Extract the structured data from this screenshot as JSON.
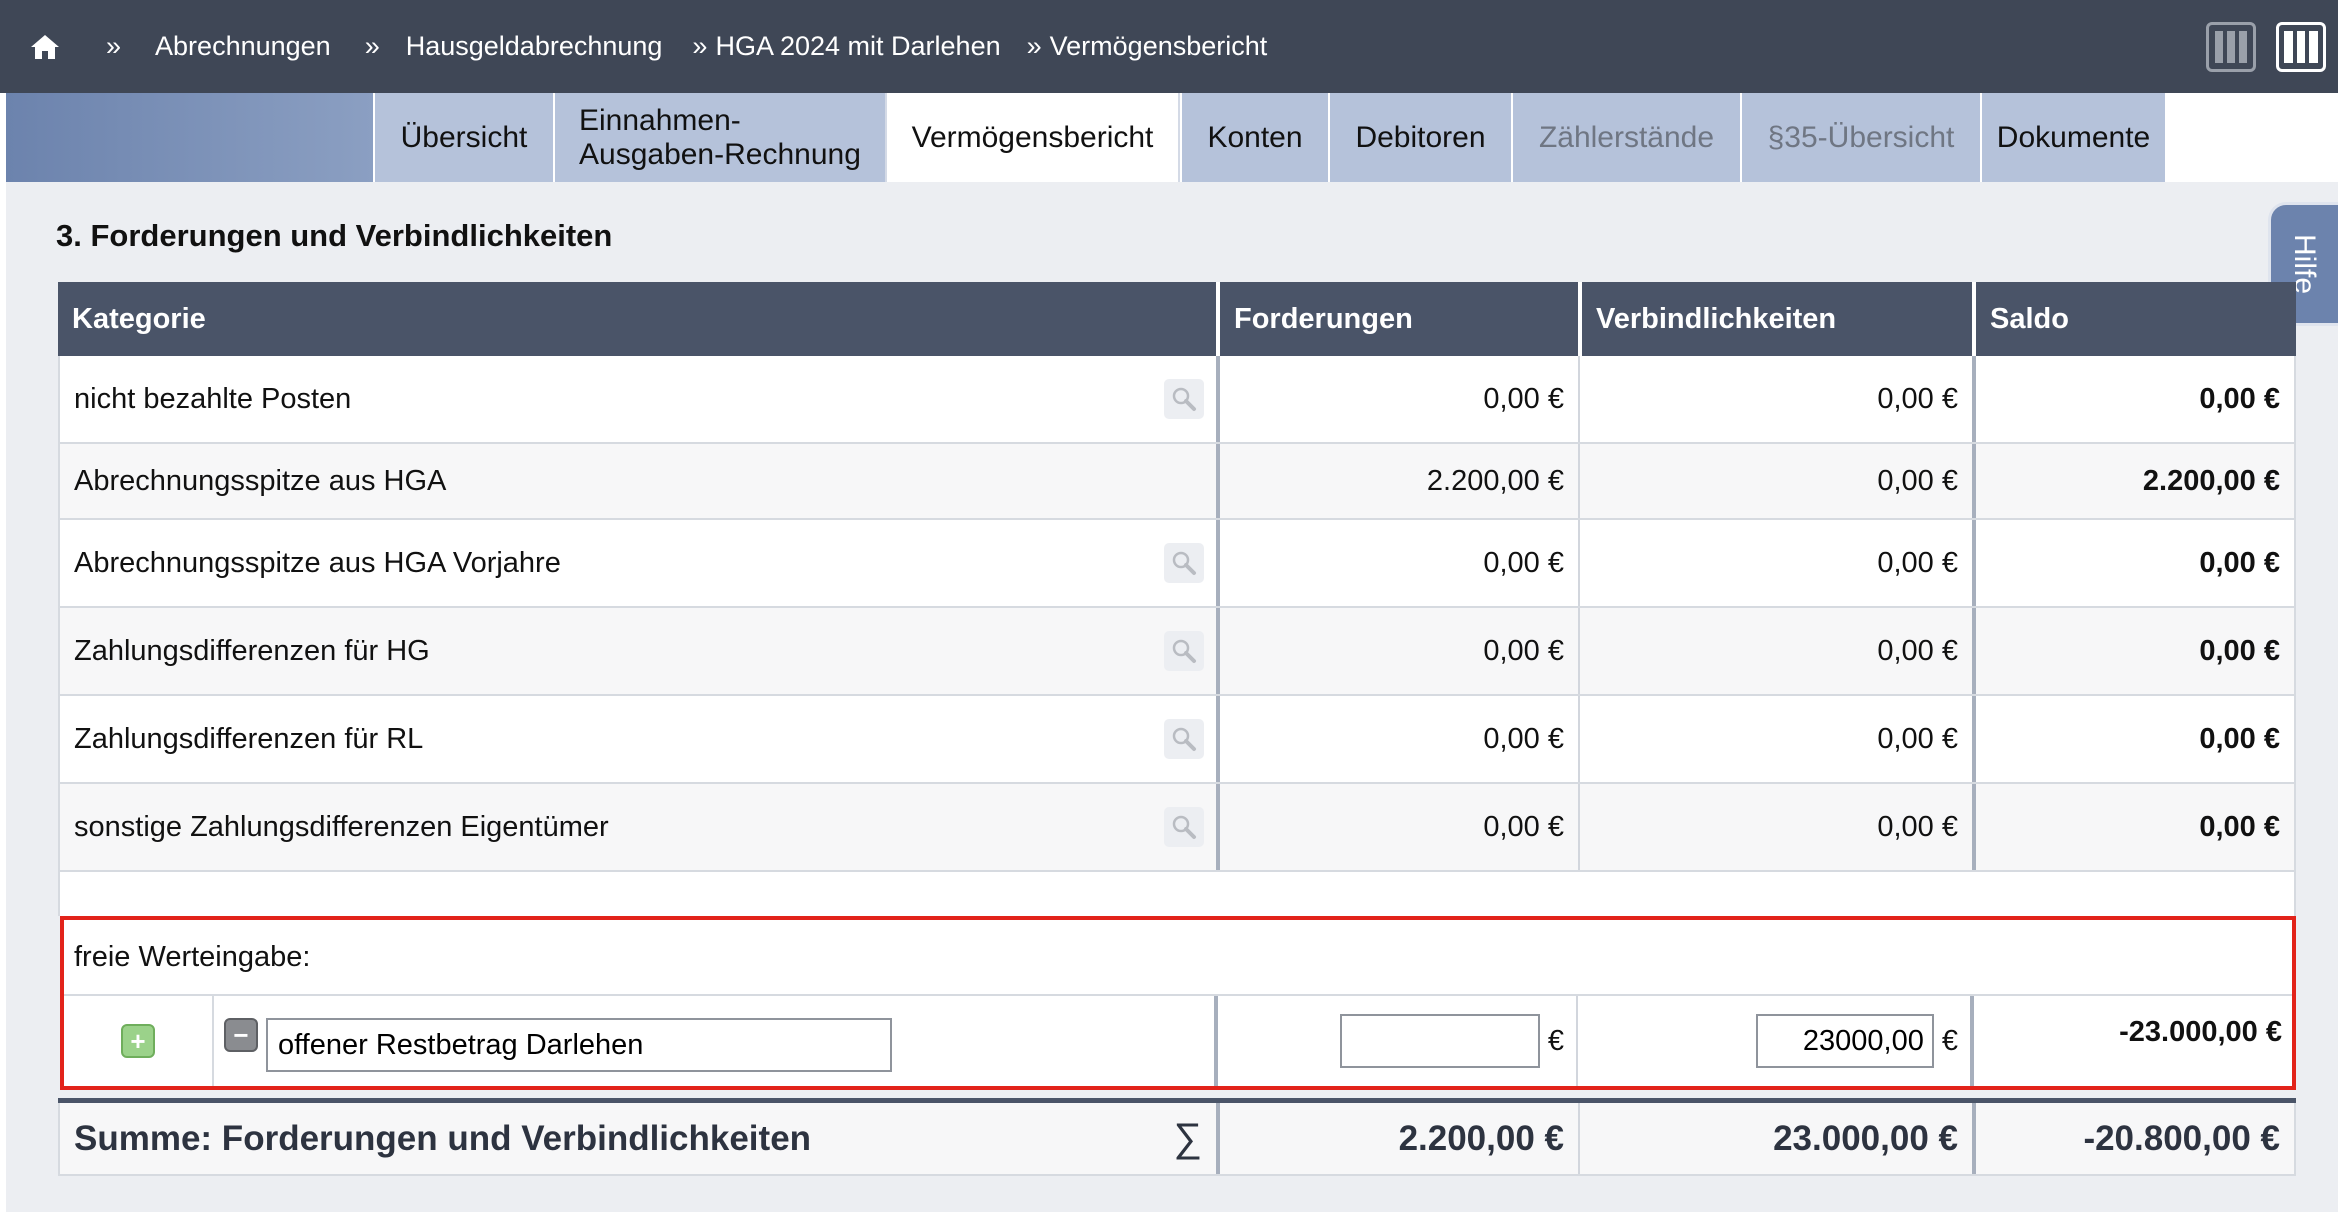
{
  "breadcrumb": {
    "home_icon": "home-icon",
    "separator": "»",
    "items": [
      "Abrechnungen",
      "Hausgeldabrechnung",
      "HGA 2024 mit Darlehen",
      "Vermögensbericht"
    ]
  },
  "layout_icons": [
    "layout-columns-icon",
    "layout-wide-icon"
  ],
  "tabs": [
    {
      "label": "Übersicht",
      "state": "normal"
    },
    {
      "label": "Einnahmen-Ausgaben-Rechnung",
      "state": "normal"
    },
    {
      "label": "Vermögensbericht",
      "state": "active"
    },
    {
      "label": "Konten",
      "state": "normal"
    },
    {
      "label": "Debitoren",
      "state": "normal"
    },
    {
      "label": "Zählerstände",
      "state": "disabled"
    },
    {
      "label": "§35-Übersicht",
      "state": "disabled"
    },
    {
      "label": "Dokumente",
      "state": "normal"
    }
  ],
  "help": {
    "label": "Hilfe"
  },
  "section": {
    "title": "3. Forderungen und Verbindlichkeiten"
  },
  "table": {
    "headers": [
      "Kategorie",
      "Forderungen",
      "Verbindlichkeiten",
      "Saldo"
    ],
    "rows": [
      {
        "kategorie": "nicht bezahlte Posten",
        "forderungen": "0,00 €",
        "verbindlichkeiten": "0,00 €",
        "saldo": "0,00 €",
        "has_search": true
      },
      {
        "kategorie": "Abrechnungsspitze aus HGA",
        "forderungen": "2.200,00 €",
        "verbindlichkeiten": "0,00 €",
        "saldo": "2.200,00 €",
        "has_search": false
      },
      {
        "kategorie": "Abrechnungsspitze aus HGA Vorjahre",
        "forderungen": "0,00 €",
        "verbindlichkeiten": "0,00 €",
        "saldo": "0,00 €",
        "has_search": true
      },
      {
        "kategorie": "Zahlungsdifferenzen für HG",
        "forderungen": "0,00 €",
        "verbindlichkeiten": "0,00 €",
        "saldo": "0,00 €",
        "has_search": true
      },
      {
        "kategorie": "Zahlungsdifferenzen für RL",
        "forderungen": "0,00 €",
        "verbindlichkeiten": "0,00 €",
        "saldo": "0,00 €",
        "has_search": true
      },
      {
        "kategorie": "sonstige Zahlungsdifferenzen Eigentümer",
        "forderungen": "0,00 €",
        "verbindlichkeiten": "0,00 €",
        "saldo": "0,00 €",
        "has_search": true
      }
    ],
    "free_entry": {
      "label": "freie Werteingabe:",
      "description_value": "offener Restbetrag Darlehen",
      "forderungen_value": "",
      "verbindlichkeiten_value": "23000,00",
      "currency": "€",
      "saldo": "-23.000,00 €"
    },
    "sum": {
      "label": "Summe: Forderungen und Verbindlichkeiten",
      "sigma": "∑",
      "forderungen": "2.200,00 €",
      "verbindlichkeiten": "23.000,00 €",
      "saldo": "-20.800,00 €"
    }
  },
  "colors": {
    "topbar": "#3f4756",
    "table_header": "#4a5468",
    "tab_inactive": "#b5c2da",
    "highlight_border": "#e2231a",
    "help_tab": "#6c83ad"
  }
}
